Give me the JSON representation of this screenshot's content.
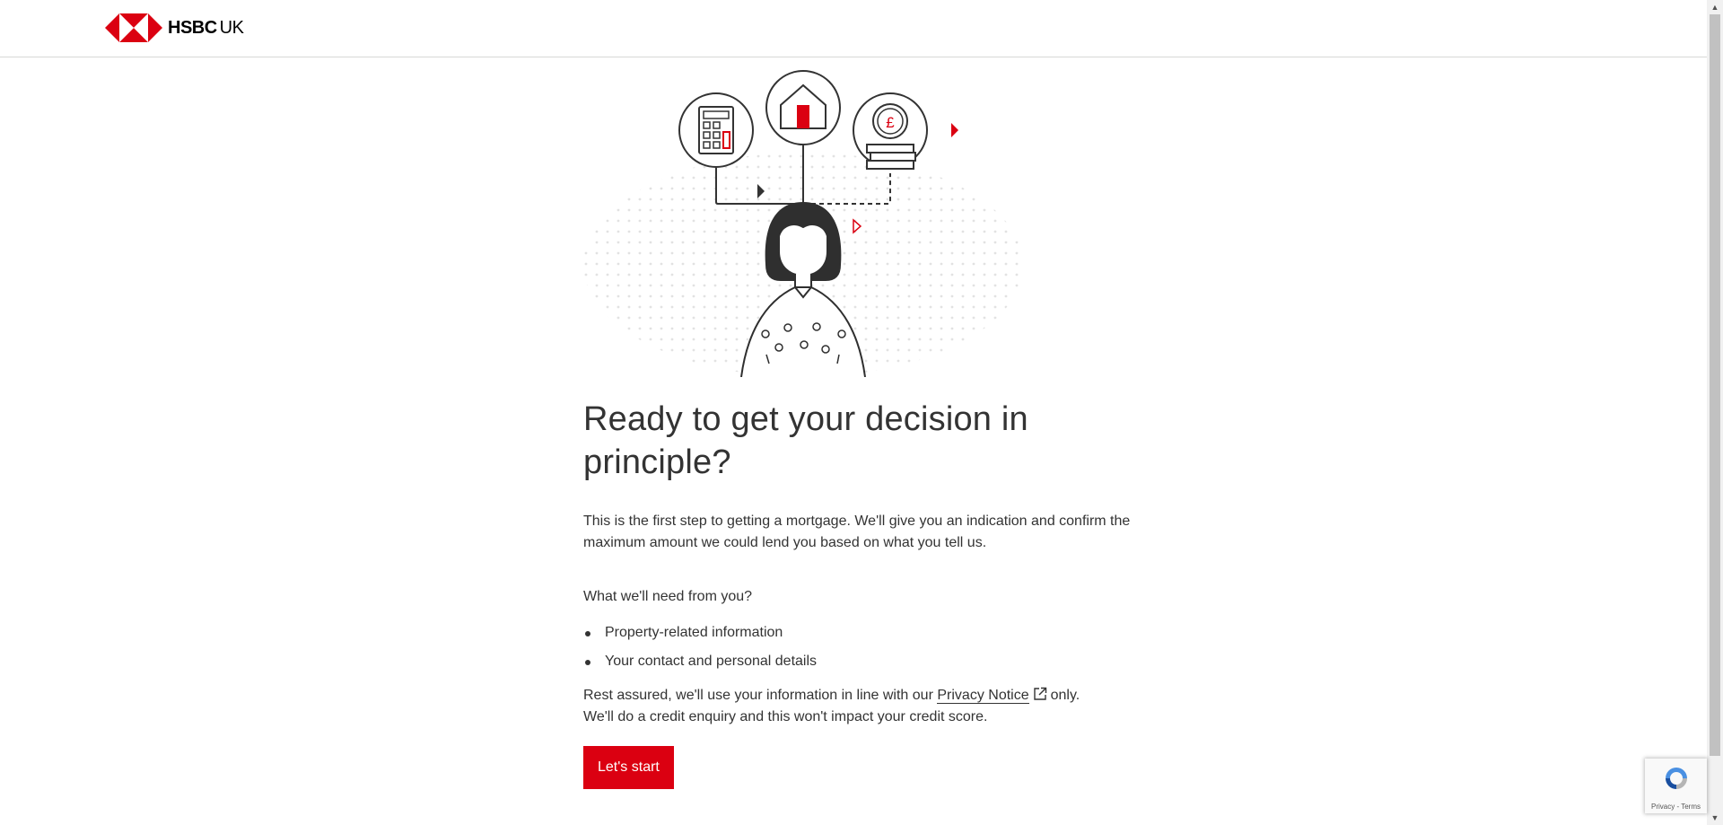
{
  "header": {
    "brand_bold": "HSBC",
    "brand_suffix": "UK"
  },
  "main": {
    "title": "Ready to get your decision in principle?",
    "intro": "This is the first step to getting a mortgage. We'll give you an indication and confirm the maximum amount we could lend you based on what you tell us.",
    "need_heading": "What we'll need from you?",
    "needs": [
      "Property-related information",
      "Your contact and personal details"
    ],
    "assurance_before": "Rest assured, we'll use your information in line with our",
    "privacy_link": "Privacy Notice",
    "assurance_after": "only.",
    "assurance_line2": "We'll do a credit enquiry and this won't impact your credit score.",
    "start_button": "Let's start"
  },
  "recaptcha": {
    "links": "Privacy - Terms"
  },
  "icons": [
    "hsbc-hexagon-logo",
    "calculator-icon",
    "house-icon",
    "pound-coin-icon",
    "person-illustration",
    "external-link-icon",
    "recaptcha-icon"
  ],
  "colors": {
    "brand_red": "#db0011",
    "text": "#333333",
    "divider": "#d7d8d6"
  }
}
